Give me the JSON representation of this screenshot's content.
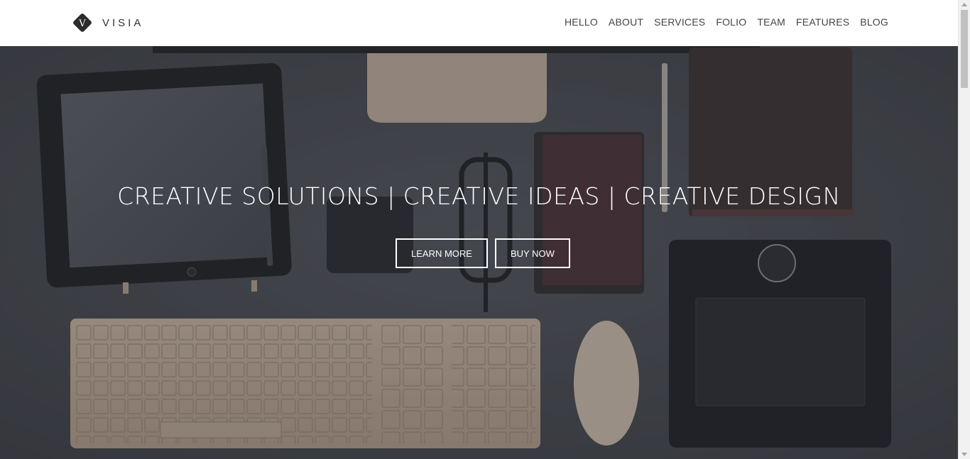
{
  "brand": {
    "logo_letter": "V",
    "name": "VISIA"
  },
  "nav": {
    "items": [
      "HELLO",
      "ABOUT",
      "SERVICES",
      "FOLIO",
      "TEAM",
      "FEATURES",
      "BLOG"
    ]
  },
  "hero": {
    "title": "CREATIVE SOLUTIONS | CREATIVE IDEAS | CREATIVE DESIGN",
    "buttons": {
      "learn_more": "LEARN MORE",
      "buy_now": "BUY NOW"
    }
  },
  "colors": {
    "hero_overlay": "#3e4148",
    "header_bg": "#ffffff",
    "nav_text": "#444444",
    "hero_text": "#ffffff"
  }
}
